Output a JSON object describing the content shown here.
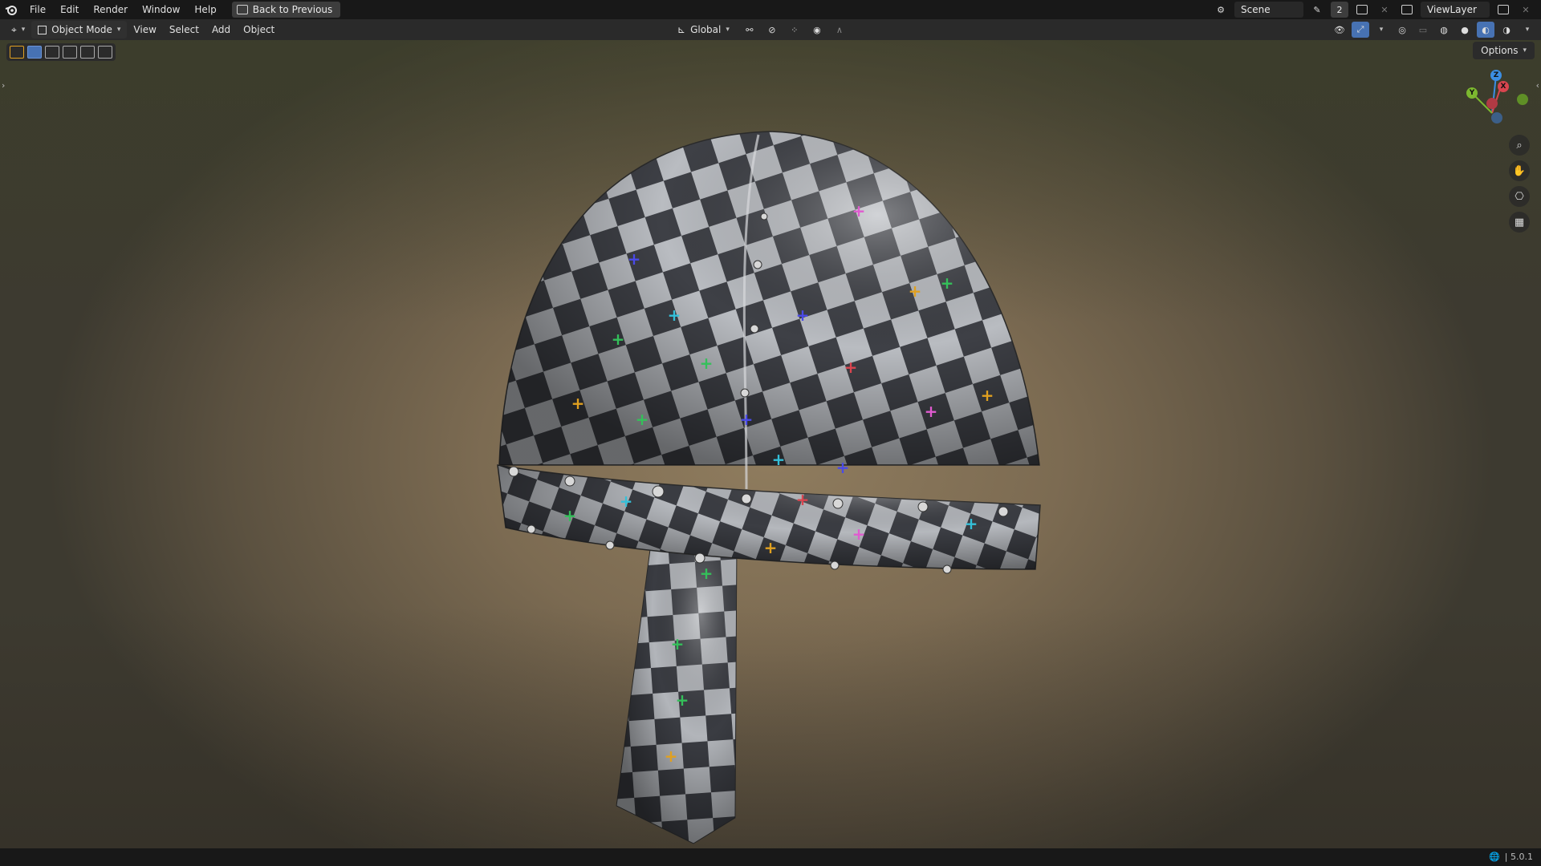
{
  "menubar": {
    "items": [
      "File",
      "Edit",
      "Render",
      "Window",
      "Help"
    ],
    "back_button": "Back to Previous",
    "scene_name": "Scene",
    "scene_count": "2",
    "view_layer": "ViewLayer"
  },
  "header": {
    "mode": "Object Mode",
    "menus": [
      "View",
      "Select",
      "Add",
      "Object"
    ],
    "transform_orientation": "Global"
  },
  "viewport": {
    "options_label": "Options",
    "gizmo_axes": {
      "x": "X",
      "y": "Y",
      "z": "Z"
    }
  },
  "status": {
    "version": "| 5.0.1"
  },
  "colors": {
    "accent": "#4772b3",
    "axis_x": "#d9454f",
    "axis_y": "#7cb82f",
    "axis_z": "#3b8ee3"
  }
}
